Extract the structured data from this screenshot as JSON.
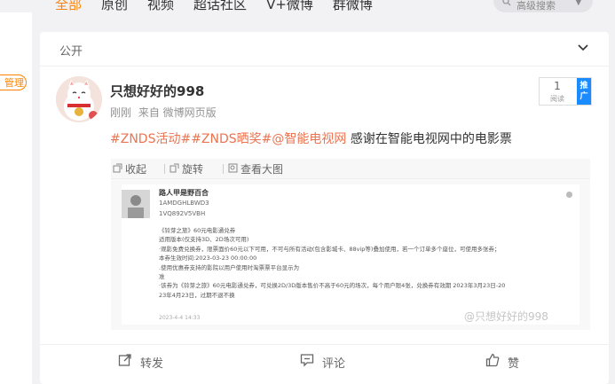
{
  "nav": {
    "tabs": [
      "全部",
      "原创",
      "视频",
      "超话社区",
      "V+微博",
      "群微博"
    ],
    "active_index": 0,
    "search_placeholder": "高级搜索",
    "accent": "#ff8200"
  },
  "sidebar": {
    "tag_label": "管理"
  },
  "card": {
    "section_title": "公开",
    "user": {
      "name": "只想好好的998",
      "time": "刚刚",
      "source": "来自 微博网页版"
    },
    "follow_widget": {
      "count": "1",
      "label": "阅读",
      "button": "推广"
    },
    "post": {
      "topics": "#ZNDS活动##ZNDS晒奖#@智能电视网",
      "text": " 感谢在智能电视网中的电影票",
      "topic_color": "#eb7350"
    },
    "media_toolbar": {
      "collapse": "收起",
      "rotate": "旋转",
      "view_large": "查看大图"
    },
    "image": {
      "name": "路人甲是野百合",
      "id1": "1AMDGHLBWD3",
      "id2": "1VQ892V5VBH",
      "lines": [
        "《铃芽之旅》60元电影通兑券",
        "适用版本(仅支持3D、2D场次可用)",
        "·观影免费兑换券，限票面价60元以下可用，不可与所有活动(包含影城卡、88vip等)叠加使用，若一个订单多个座位，可使用多张券；",
        "本券生效时间:2023-03-23 00:00:00",
        ".使用优惠券支持的影院以用户使用时淘票票平台显示为",
        "准",
        "·该券为《铃芽之旅》60元电影通兑券，可兑换2D/3D版本售价不高于60元的场次，每个用户限4张，兑换券有效期 2023年3月23日-20",
        "23年4月23日，过期不退不换"
      ],
      "date": "2023-4-4 14:33",
      "watermark": "@只想好好的998"
    },
    "actions": {
      "repost": "转发",
      "comment": "评论",
      "like": "赞"
    }
  }
}
